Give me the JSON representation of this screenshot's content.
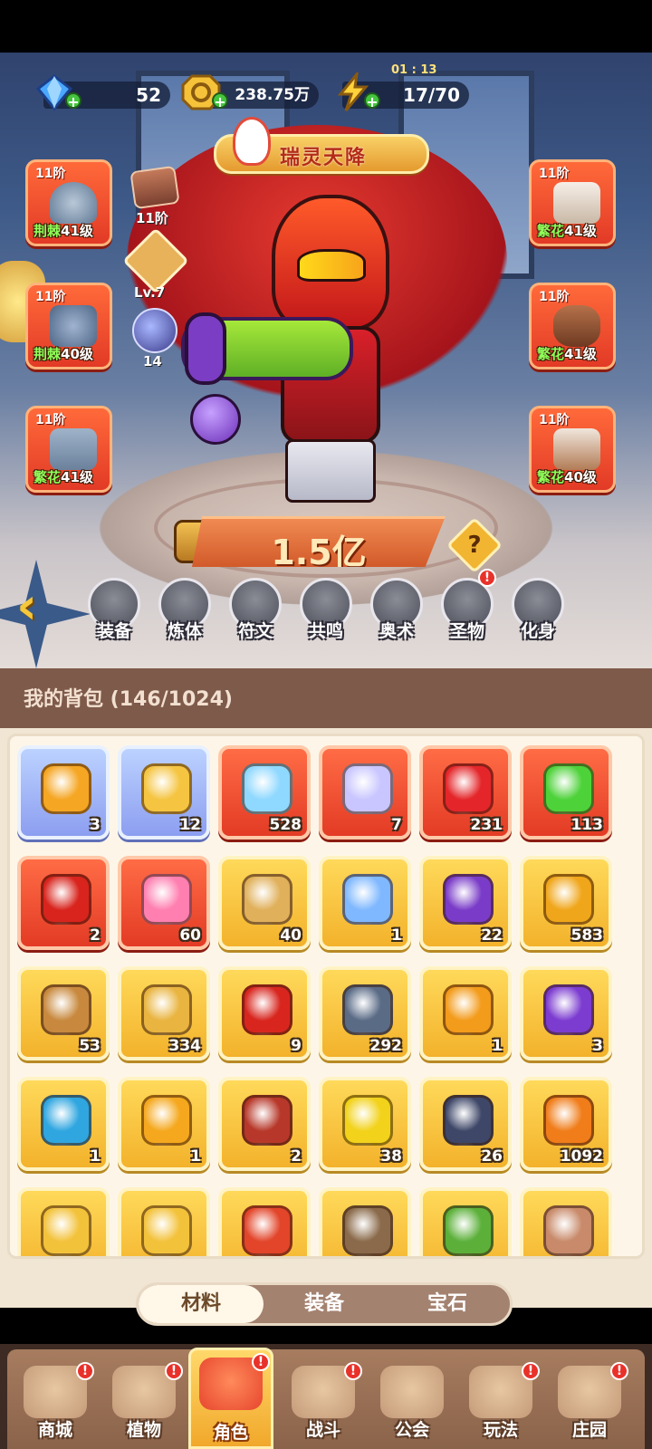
{
  "currencies": [
    {
      "name": "gem",
      "value": "52",
      "color": "#4aa8ff"
    },
    {
      "name": "gold",
      "value": "238.75万",
      "color": "#f6c23a"
    },
    {
      "name": "energy",
      "value": "17/70",
      "color": "#ffd23a"
    }
  ],
  "energy_timer": "01 : 13",
  "banner": {
    "title": "瑞灵天降"
  },
  "gear_left": [
    {
      "tier": "11阶",
      "set": "荆棘",
      "level": "41级",
      "icon": "hat-icon"
    },
    {
      "tier": "11阶",
      "set": "荆棘",
      "level": "40级",
      "icon": "glove-icon"
    },
    {
      "tier": "11阶",
      "set": "繁花",
      "level": "41级",
      "icon": "shorts-icon"
    }
  ],
  "gear_right": [
    {
      "tier": "11阶",
      "set": "繁花",
      "level": "41级",
      "icon": "shirt-icon"
    },
    {
      "tier": "11阶",
      "set": "繁花",
      "level": "41级",
      "icon": "belt-icon"
    },
    {
      "tier": "11阶",
      "set": "繁花",
      "level": "40级",
      "icon": "boots-icon"
    }
  ],
  "side_stats": {
    "relic_tier": "11阶",
    "star_level": "Lv.7",
    "skill_count": "14"
  },
  "power": "1.5亿",
  "help_symbol": "?",
  "func_tabs": [
    {
      "label": "装备",
      "icon": "equip-icon",
      "badge": false
    },
    {
      "label": "炼体",
      "icon": "body-icon",
      "badge": false
    },
    {
      "label": "符文",
      "icon": "rune-icon",
      "badge": false
    },
    {
      "label": "共鸣",
      "icon": "resonance-icon",
      "badge": false
    },
    {
      "label": "奥术",
      "icon": "arcane-icon",
      "badge": false
    },
    {
      "label": "圣物",
      "icon": "relic-icon",
      "badge": true
    },
    {
      "label": "化身",
      "icon": "avatar-icon",
      "badge": false
    }
  ],
  "badge_symbol": "!",
  "bag": {
    "title": "我的背包 (146/1024)"
  },
  "items": [
    {
      "count": "3",
      "rarity": "blue",
      "icon": "duck-flower-icon",
      "color": "#f5a623"
    },
    {
      "count": "12",
      "rarity": "blue",
      "icon": "star-icon",
      "color": "#f5c542"
    },
    {
      "count": "528",
      "rarity": "red",
      "icon": "crystal-star-icon",
      "color": "#8fd8ff"
    },
    {
      "count": "7",
      "rarity": "red",
      "icon": "moon-star-icon",
      "color": "#c9c6ff"
    },
    {
      "count": "231",
      "rarity": "red",
      "icon": "red-potion-icon",
      "color": "#e4262a"
    },
    {
      "count": "113",
      "rarity": "red",
      "icon": "green-tube-icon",
      "color": "#4ed23a"
    },
    {
      "count": "2",
      "rarity": "red",
      "icon": "hero-figure-icon",
      "color": "#d8241d"
    },
    {
      "count": "60",
      "rarity": "red",
      "icon": "flame-seed-icon",
      "color": "#ff7fb0"
    },
    {
      "count": "40",
      "rarity": "gold",
      "icon": "gold-vial-icon",
      "color": "#e0b05a"
    },
    {
      "count": "1",
      "rarity": "gold",
      "icon": "water-drop-icon",
      "color": "#7fb8ff"
    },
    {
      "count": "22",
      "rarity": "gold",
      "icon": "skull-scroll-icon",
      "color": "#7a3cc8"
    },
    {
      "count": "583",
      "rarity": "gold",
      "icon": "duck-coin-icon",
      "color": "#f0a61a"
    },
    {
      "count": "53",
      "rarity": "gold",
      "icon": "basket-icon",
      "color": "#c8893e"
    },
    {
      "count": "334",
      "rarity": "gold",
      "icon": "key-icon",
      "color": "#e9b43f"
    },
    {
      "count": "9",
      "rarity": "gold",
      "icon": "flame-leaf-icon",
      "color": "#d8261f"
    },
    {
      "count": "292",
      "rarity": "gold",
      "icon": "pyramid-icon",
      "color": "#5a6b86"
    },
    {
      "count": "1",
      "rarity": "gold",
      "icon": "amber-gem-icon",
      "color": "#f39b1a"
    },
    {
      "count": "3",
      "rarity": "gold",
      "icon": "purple-orb-icon",
      "color": "#7c3cd0"
    },
    {
      "count": "1",
      "rarity": "gold",
      "icon": "mushroom-icon",
      "color": "#2fa6e0"
    },
    {
      "count": "1",
      "rarity": "gold",
      "icon": "orbit-orb-icon",
      "color": "#f5a81e"
    },
    {
      "count": "2",
      "rarity": "gold",
      "icon": "spell-book-icon",
      "color": "#b7382a"
    },
    {
      "count": "38",
      "rarity": "gold",
      "icon": "yellow-bulb-icon",
      "color": "#f2d21a"
    },
    {
      "count": "26",
      "rarity": "gold",
      "icon": "rune-stone-icon",
      "color": "#3e4768"
    },
    {
      "count": "1092",
      "rarity": "gold",
      "icon": "orange-potion-icon",
      "color": "#f07d1a"
    },
    {
      "count": "",
      "rarity": "gold",
      "icon": "gold-shard-icon",
      "color": "#f3c23b"
    },
    {
      "count": "",
      "rarity": "gold",
      "icon": "gold-ore-icon",
      "color": "#f3c23b"
    },
    {
      "count": "",
      "rarity": "gold",
      "icon": "red-flower-icon",
      "color": "#e2452a"
    },
    {
      "count": "",
      "rarity": "gold",
      "icon": "pot-icon",
      "color": "#8a6a4a"
    },
    {
      "count": "",
      "rarity": "gold",
      "icon": "green-machine-icon",
      "color": "#5cb03a"
    },
    {
      "count": "",
      "rarity": "gold",
      "icon": "rock-icon",
      "color": "#c88a6a"
    }
  ],
  "bag_tabs": [
    {
      "label": "材料",
      "active": true
    },
    {
      "label": "装备",
      "active": false
    },
    {
      "label": "宝石",
      "active": false
    }
  ],
  "bottom_nav": [
    {
      "label": "商城",
      "icon": "shop-icon",
      "badge": true,
      "active": false
    },
    {
      "label": "植物",
      "icon": "plant-icon",
      "badge": true,
      "active": false
    },
    {
      "label": "角色",
      "icon": "character-icon",
      "badge": true,
      "active": true
    },
    {
      "label": "战斗",
      "icon": "battle-icon",
      "badge": true,
      "active": false
    },
    {
      "label": "公会",
      "icon": "guild-icon",
      "badge": false,
      "active": false
    },
    {
      "label": "玩法",
      "icon": "gameplay-icon",
      "badge": true,
      "active": false
    },
    {
      "label": "庄园",
      "icon": "manor-icon",
      "badge": true,
      "active": false
    }
  ]
}
